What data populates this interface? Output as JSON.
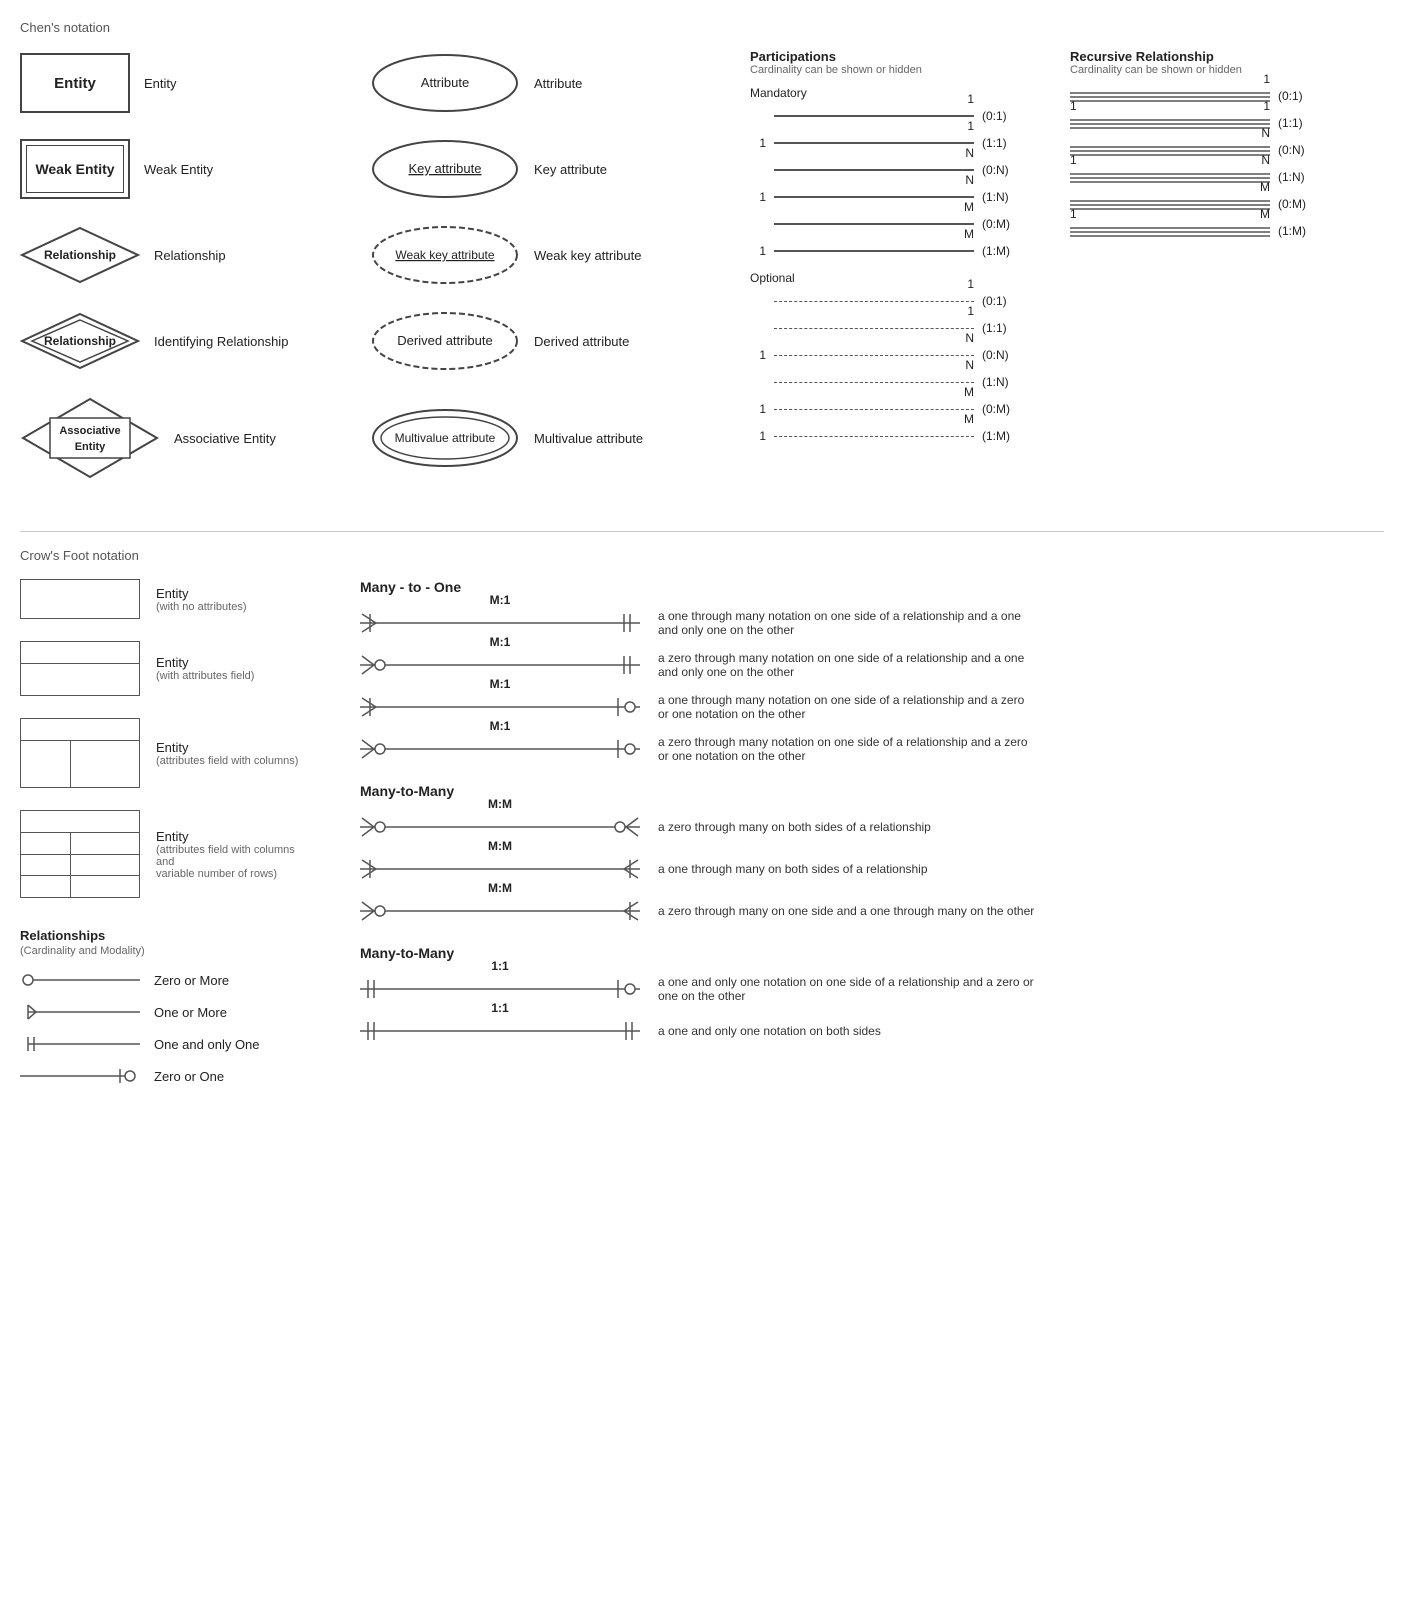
{
  "chens": {
    "title": "Chen's notation",
    "entities": [
      {
        "label": "Entity",
        "desc": "Entity",
        "type": "entity"
      },
      {
        "label": "Weak Entity",
        "desc": "Weak Entity",
        "type": "weak-entity"
      },
      {
        "label": "Relationship",
        "desc": "Relationship",
        "type": "diamond"
      },
      {
        "label": "Relationship",
        "desc": "Identifying Relationship",
        "type": "diamond-double"
      },
      {
        "label": "Associative\nEntity",
        "desc": "Associative Entity",
        "type": "assoc-entity"
      }
    ],
    "attributes": [
      {
        "label": "Attribute",
        "desc": "Attribute",
        "type": "ellipse"
      },
      {
        "label": "Key attribute",
        "desc": "Key attribute",
        "type": "ellipse-underline"
      },
      {
        "label": "Weak key attribute",
        "desc": "Weak key attribute",
        "type": "ellipse-underline-dashed"
      },
      {
        "label": "Derived attribute",
        "desc": "Derived attribute",
        "type": "ellipse-dashed"
      },
      {
        "label": "Multivalue attribute",
        "desc": "Multivalue attribute",
        "type": "ellipse-double"
      }
    ]
  },
  "participations": {
    "title": "Participations",
    "subtitle": "Cardinality can be shown or hidden",
    "mandatory": {
      "label": "Mandatory",
      "rows": [
        {
          "left": "",
          "right": "1",
          "notation": "(0:1)"
        },
        {
          "left": "1",
          "right": "1",
          "notation": "(1:1)"
        },
        {
          "left": "",
          "right": "N",
          "notation": "(0:N)"
        },
        {
          "left": "1",
          "right": "N",
          "notation": "(1:N)"
        },
        {
          "left": "",
          "right": "M",
          "notation": "(0:M)"
        },
        {
          "left": "1",
          "right": "M",
          "notation": "(1:M)"
        }
      ]
    },
    "optional": {
      "label": "Optional",
      "rows": [
        {
          "left": "",
          "right": "1",
          "notation": "(0:1)"
        },
        {
          "left": "",
          "right": "1",
          "notation": "(1:1)"
        },
        {
          "left": "1",
          "right": "N",
          "notation": "(0:N)"
        },
        {
          "left": "",
          "right": "N",
          "notation": "(1:N)"
        },
        {
          "left": "1",
          "right": "M",
          "notation": "(0:M)"
        },
        {
          "left": "1",
          "right": "M",
          "notation": "(1:M)"
        }
      ]
    }
  },
  "recursive": {
    "title": "Recursive Relationship",
    "subtitle": "Cardinality can be shown or hidden",
    "rows": [
      {
        "left": "",
        "right": "1",
        "notation": "(0:1)"
      },
      {
        "left": "1",
        "right": "1",
        "notation": "(1:1)"
      },
      {
        "left": "",
        "right": "N",
        "notation": "(0:N)"
      },
      {
        "left": "1",
        "right": "N",
        "notation": "(1:N)"
      },
      {
        "left": "",
        "right": "M",
        "notation": "(0:M)"
      },
      {
        "left": "1",
        "right": "M",
        "notation": "(1:M)"
      }
    ]
  },
  "crows": {
    "title": "Crow's Foot notation",
    "entities": [
      {
        "label": "Entity",
        "sublabel": "(with no attributes)",
        "type": "plain"
      },
      {
        "label": "Entity",
        "sublabel": "(with attributes field)",
        "type": "attrs"
      },
      {
        "label": "Entity",
        "sublabel": "(attributes field with columns)",
        "type": "cols"
      },
      {
        "label": "Entity",
        "sublabel": "(attributes field with columns and\nvariable number of rows)",
        "type": "varrows"
      }
    ],
    "relationships": {
      "title": "Relationships",
      "subtitle": "(Cardinality and Modality)",
      "symbols": [
        {
          "label": "Zero or More",
          "type": "zero-or-more"
        },
        {
          "label": "One or More",
          "type": "one-or-more"
        },
        {
          "label": "One and only One",
          "type": "one-and-only-one"
        },
        {
          "label": "Zero or One",
          "type": "zero-or-one"
        }
      ]
    },
    "manyToOne": {
      "title": "Many - to - One",
      "rows": [
        {
          "label": "M:1",
          "leftSymbol": "one-or-more",
          "rightSymbol": "one-and-only-one",
          "desc": "a one through many notation on one side of a relationship and a one and only one on the other"
        },
        {
          "label": "M:1",
          "leftSymbol": "zero-or-more",
          "rightSymbol": "one-and-only-one",
          "desc": "a zero through many notation on one side of a relationship and a one and only one on the other"
        },
        {
          "label": "M:1",
          "leftSymbol": "one-or-more",
          "rightSymbol": "zero-or-one",
          "desc": "a one through many notation on one side of a relationship and a zero or one notation on the other"
        },
        {
          "label": "M:1",
          "leftSymbol": "zero-or-more",
          "rightSymbol": "zero-or-one",
          "desc": "a zero through many notation on one side of a relationship and a zero or one notation on the other"
        }
      ]
    },
    "manyToMany": {
      "title": "Many-to-Many",
      "rows": [
        {
          "label": "M:M",
          "leftSymbol": "zero-or-more",
          "rightSymbol": "zero-or-more-right",
          "desc": "a zero through many on both sides of a relationship"
        },
        {
          "label": "M:M",
          "leftSymbol": "one-or-more",
          "rightSymbol": "one-or-more-right",
          "desc": "a one through many on both sides of a relationship"
        },
        {
          "label": "M:M",
          "leftSymbol": "zero-or-more",
          "rightSymbol": "one-or-more-right",
          "desc": "a zero through many on one side and a one through many on the other"
        }
      ]
    },
    "oneToOne": {
      "title": "Many-to-Many",
      "rows": [
        {
          "label": "1:1",
          "leftSymbol": "one-and-only-one",
          "rightSymbol": "zero-or-one",
          "desc": "a one and only one notation on one side of a relationship and a zero or one on the other"
        },
        {
          "label": "1:1",
          "leftSymbol": "one-and-only-one",
          "rightSymbol": "one-and-only-one-right",
          "desc": "a one and only one notation on both sides"
        }
      ]
    }
  }
}
